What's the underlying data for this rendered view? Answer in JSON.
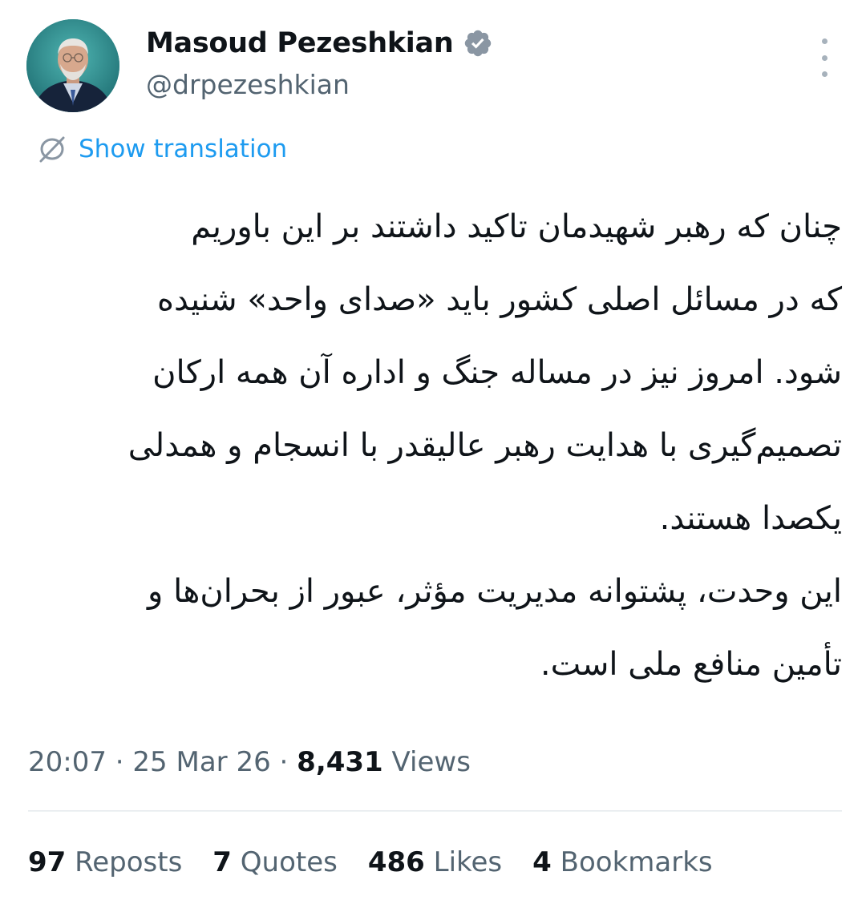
{
  "author": {
    "display_name": "Masoud Pezeshkian",
    "handle": "@drpezeshkian",
    "verified": true,
    "verified_color": "#8a96a3",
    "avatar_icon": "profile-photo"
  },
  "translation": {
    "label": "Show translation",
    "icon": "translate-globe-icon",
    "color": "#1d9bf0"
  },
  "body": {
    "paragraph1_lines": [
      "چنان که رهبر شهیدمان تاکید داشتند بر این باوریم",
      "که در مسائل اصلی کشور باید «صدای واحد» شنیده",
      "شود. امروز نیز در مساله جنگ و اداره آن همه ارکان",
      "تصمیم‌گیری با هدایت رهبر عالیقدر با انسجام و همدلی",
      "یکصدا هستند."
    ],
    "paragraph2_lines": [
      "این وحدت، پشتوانه مدیریت مؤثر، عبور از بحران‌ها و",
      "تأمین منافع ملی است."
    ]
  },
  "meta": {
    "time": "20:07",
    "separator": " · ",
    "date": "25 Mar 26",
    "views_count": "8,431",
    "views_label": " Views"
  },
  "stats": {
    "reposts_count": "97",
    "reposts_label": " Reposts",
    "quotes_count": "7",
    "quotes_label": " Quotes",
    "likes_count": "486",
    "likes_label": " Likes",
    "bookmarks_count": "4",
    "bookmarks_label": " Bookmarks"
  },
  "colors": {
    "primary_text": "#0f1419",
    "secondary_text": "#536471",
    "link": "#1d9bf0",
    "divider": "#eff3f4"
  }
}
